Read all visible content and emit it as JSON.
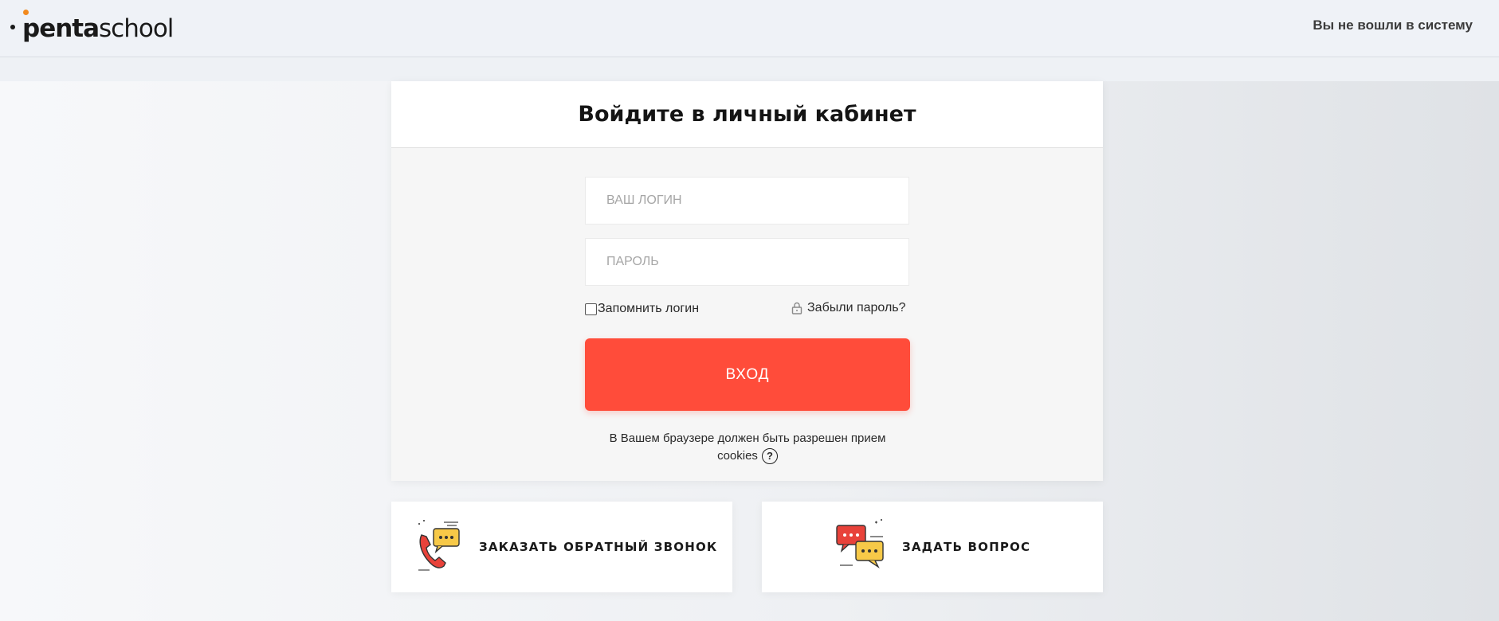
{
  "header": {
    "logo_text_bold": "penta",
    "logo_text_light": "school",
    "login_status": "Вы не вошли в систему"
  },
  "login_card": {
    "title": "Войдите в личный кабинет",
    "login_placeholder": "ВАШ ЛОГИН",
    "password_placeholder": "ПАРОЛЬ",
    "remember_label": "Запомнить логин",
    "forgot_label": "Забыли пароль?",
    "submit_label": "ВХОД",
    "cookies_line1": "В Вашем браузере должен быть разрешен прием",
    "cookies_line2": "cookies",
    "help_glyph": "?"
  },
  "tiles": {
    "callback_label": "ЗАКАЗАТЬ ОБРАТНЫЙ ЗВОНОК",
    "question_label": "ЗАДАТЬ ВОПРОС"
  },
  "icons": {
    "logo": "pentaschool-logo",
    "lock": "lock-icon",
    "help": "question-circle-icon",
    "callback": "phone-chat-icon",
    "question": "chat-bubbles-icon"
  },
  "colors": {
    "accent": "#ff4c3a",
    "logo_dot": "#f28a1e",
    "icon_yellow": "#f7c948",
    "icon_red": "#e8423a"
  }
}
